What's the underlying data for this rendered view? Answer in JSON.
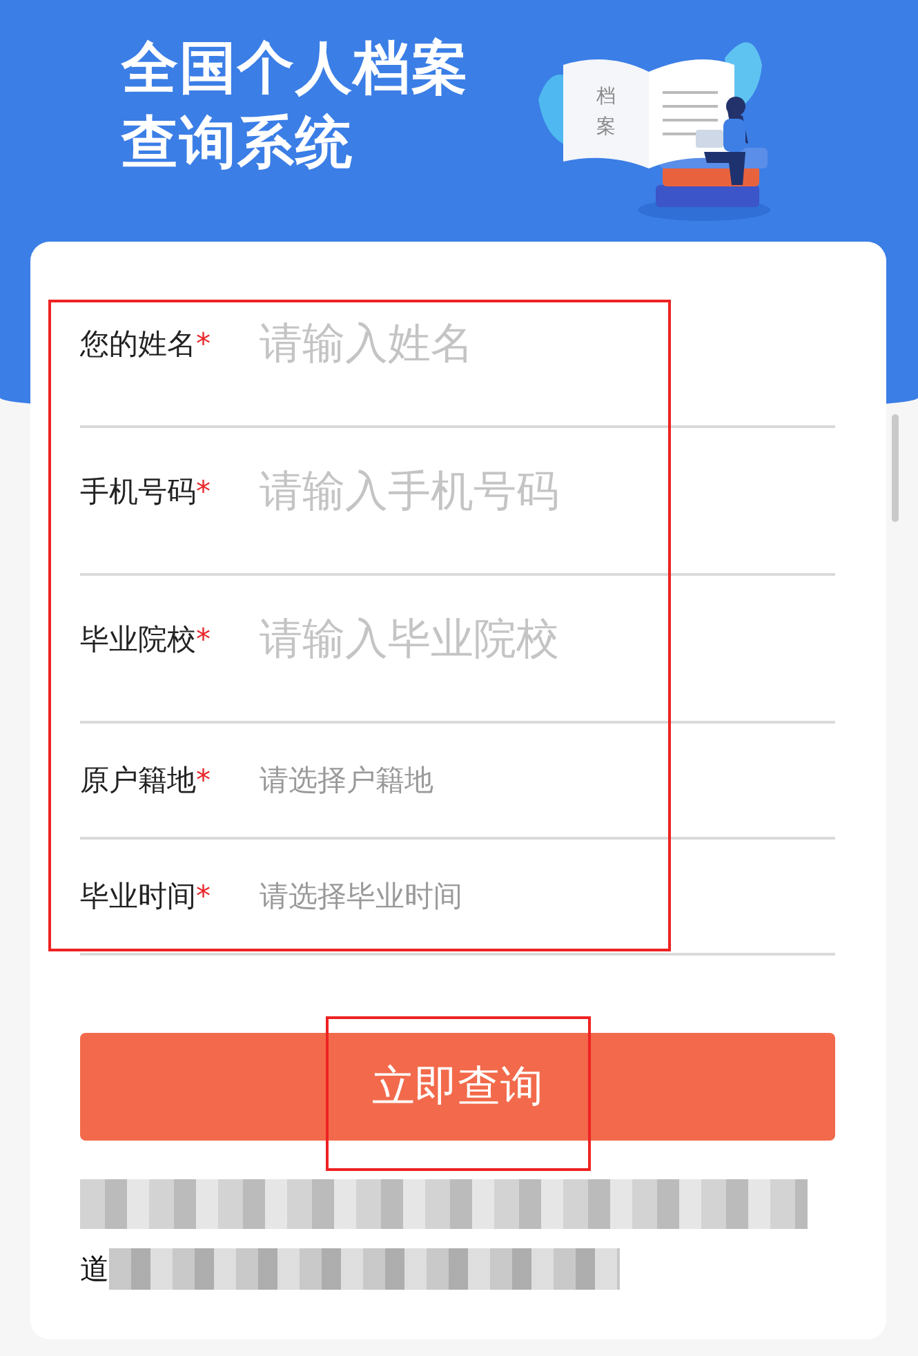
{
  "header": {
    "title_lines": [
      "全国个人档案",
      "查询系统"
    ],
    "book_page_text": "档案"
  },
  "form": {
    "marked": true,
    "fields": [
      {
        "label": "您的姓名",
        "required_mark": "*",
        "placeholder": "请输入姓名",
        "kind": "input"
      },
      {
        "label": "手机号码",
        "required_mark": "*",
        "placeholder": "请输入手机号码",
        "kind": "input"
      },
      {
        "label": "毕业院校",
        "required_mark": "*",
        "placeholder": "请输入毕业院校",
        "kind": "input"
      },
      {
        "label": "原户籍地",
        "required_mark": "*",
        "placeholder": "请选择户籍地",
        "kind": "select"
      },
      {
        "label": "毕业时间",
        "required_mark": "*",
        "placeholder": "请选择毕业时间",
        "kind": "select"
      }
    ]
  },
  "submit": {
    "label": "立即查询",
    "marked": true
  },
  "note": {
    "visible_text": "道"
  }
}
